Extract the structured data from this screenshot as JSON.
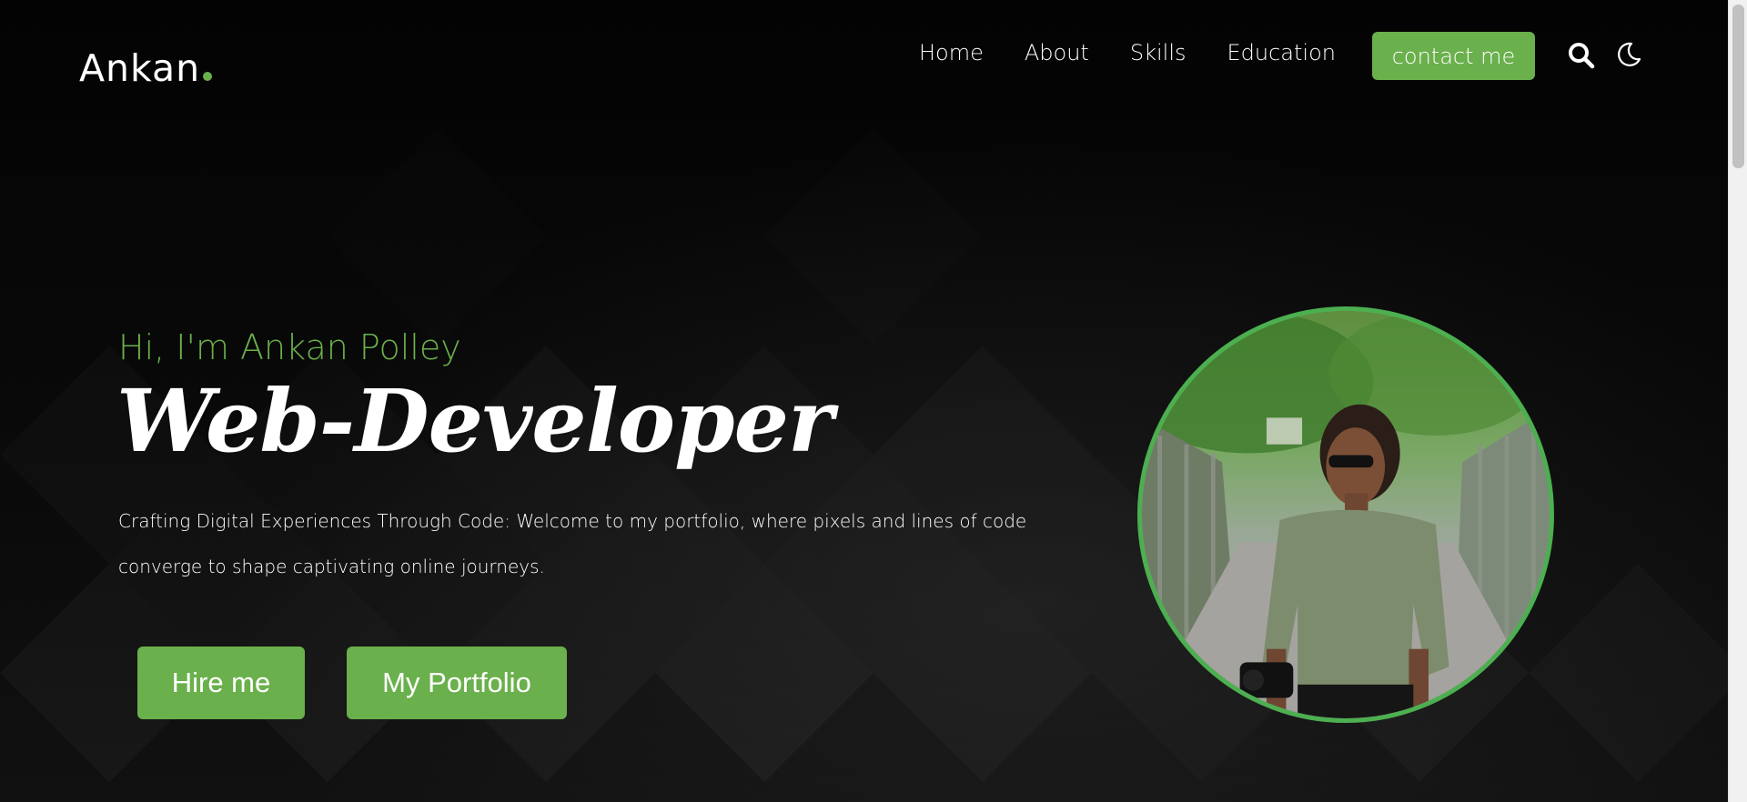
{
  "header": {
    "logo_text": "Ankan",
    "nav": [
      {
        "label": "Home"
      },
      {
        "label": "About"
      },
      {
        "label": "Skills"
      },
      {
        "label": "Education"
      }
    ],
    "contact_label": "contact me",
    "icons": [
      "search-icon",
      "moon-icon"
    ]
  },
  "hero": {
    "greeting": "Hi, I'm Ankan Polley",
    "role": "Web-Developer",
    "description": "Crafting Digital Experiences Through Code: Welcome to my portfolio, where pixels and lines of code converge to shape captivating online journeys.",
    "hire_label": "Hire me",
    "portfolio_label": "My Portfolio"
  },
  "colors": {
    "accent": "#6ab04c",
    "background": "#050505",
    "portrait_border": "#4caf50"
  }
}
